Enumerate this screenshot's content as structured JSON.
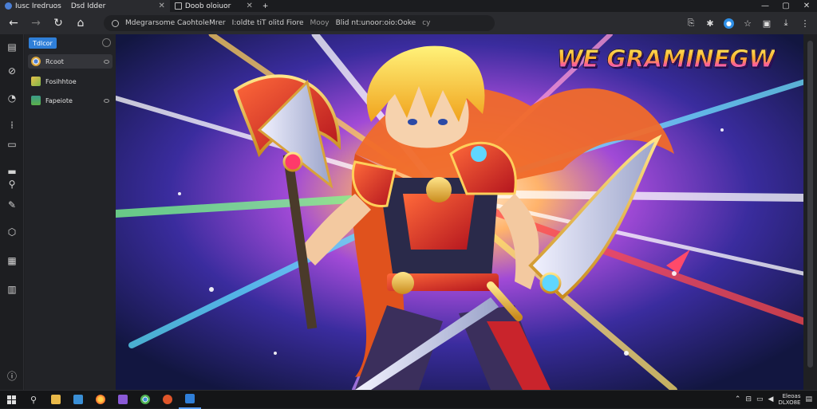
{
  "tabs": [
    {
      "label": "Iusc Iredruos",
      "active": true
    },
    {
      "label": "Dsd Idder",
      "active": true
    },
    {
      "label": "Doob oloiuor",
      "active": false
    }
  ],
  "address": {
    "segments": [
      "Mdegrarsome CaohtoleMrer",
      "I:oldte tiT olitd  Fiore",
      "Mooy",
      "Blid nt:unoor:oio:Ooke",
      "cy"
    ]
  },
  "panel": {
    "new_label": "Tdlcor",
    "items": [
      {
        "label": "Rcoot",
        "color": "#d9a43a"
      },
      {
        "label": "Fosihhtoe",
        "color": "#7fb34a"
      },
      {
        "label": "Fapeiote",
        "color": "#3a9a8a"
      }
    ]
  },
  "content": {
    "banner_text": "WE GRAMINEGW"
  },
  "tray": {
    "line1": "Eleoas",
    "line2": "DLXO8E"
  },
  "colors": {
    "accent": "#2f7fd8",
    "taskbar_active": "#5aa0ff"
  }
}
